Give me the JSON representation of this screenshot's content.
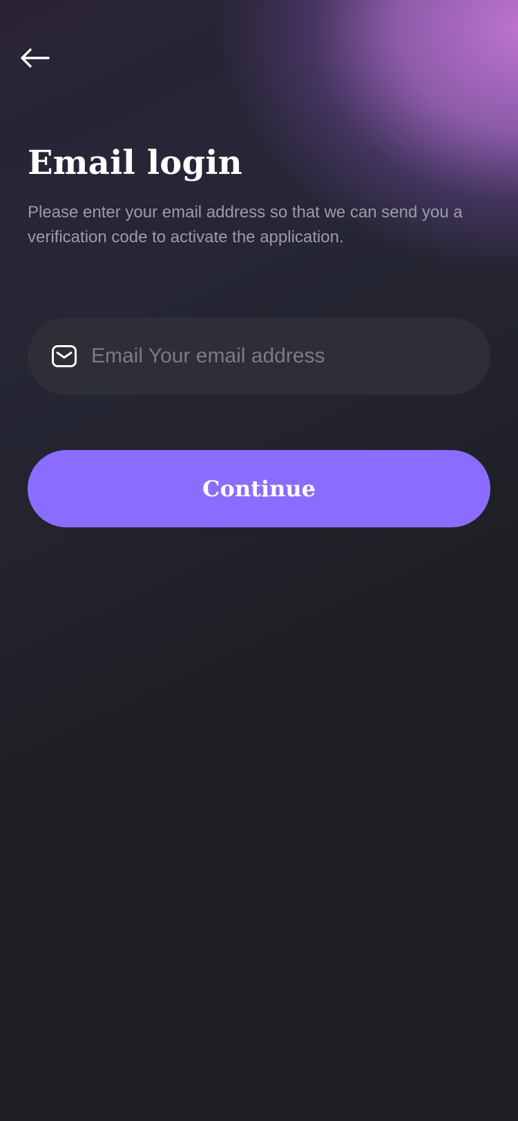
{
  "header": {
    "back_icon": "arrow-left-icon"
  },
  "main": {
    "title": "Email login",
    "subtitle": "Please enter your email address so that we can send you a verification code to activate the application.",
    "email_input": {
      "icon": "mail-icon",
      "placeholder": "Email Your email address",
      "value": ""
    },
    "continue_label": "Continue"
  },
  "colors": {
    "background": "#1d1d22",
    "accent": "#8a6dff",
    "input_background": "#2e2e37",
    "glow": "#c678d6"
  }
}
